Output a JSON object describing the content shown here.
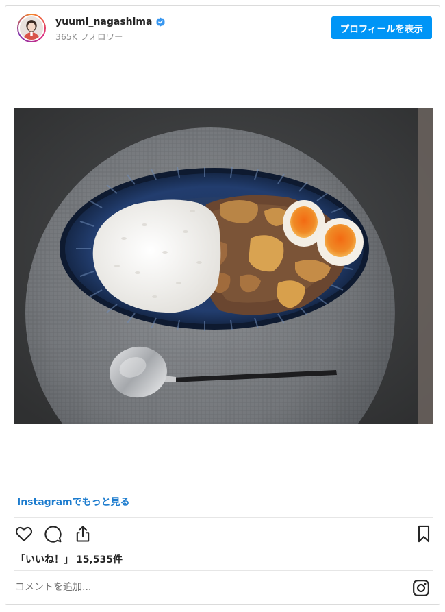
{
  "header": {
    "username": "yuumi_nagashima",
    "followers": "365K フォロワー",
    "profile_button": "プロフィールを表示"
  },
  "post": {
    "image_alt": "Curry rice with soft-boiled eggs on a blue striped oval plate with a spoon"
  },
  "more_link": "Instagramでもっと見る",
  "likes": {
    "label": "「いいね！」",
    "count": "15,535件"
  },
  "comment": {
    "placeholder": "コメントを追加..."
  },
  "colors": {
    "accent": "#0095f6",
    "link": "#1d7cce",
    "verified": "#3897f0"
  },
  "icons": [
    "heart-icon",
    "comment-icon",
    "share-icon",
    "bookmark-icon",
    "instagram-icon",
    "verified-icon"
  ]
}
